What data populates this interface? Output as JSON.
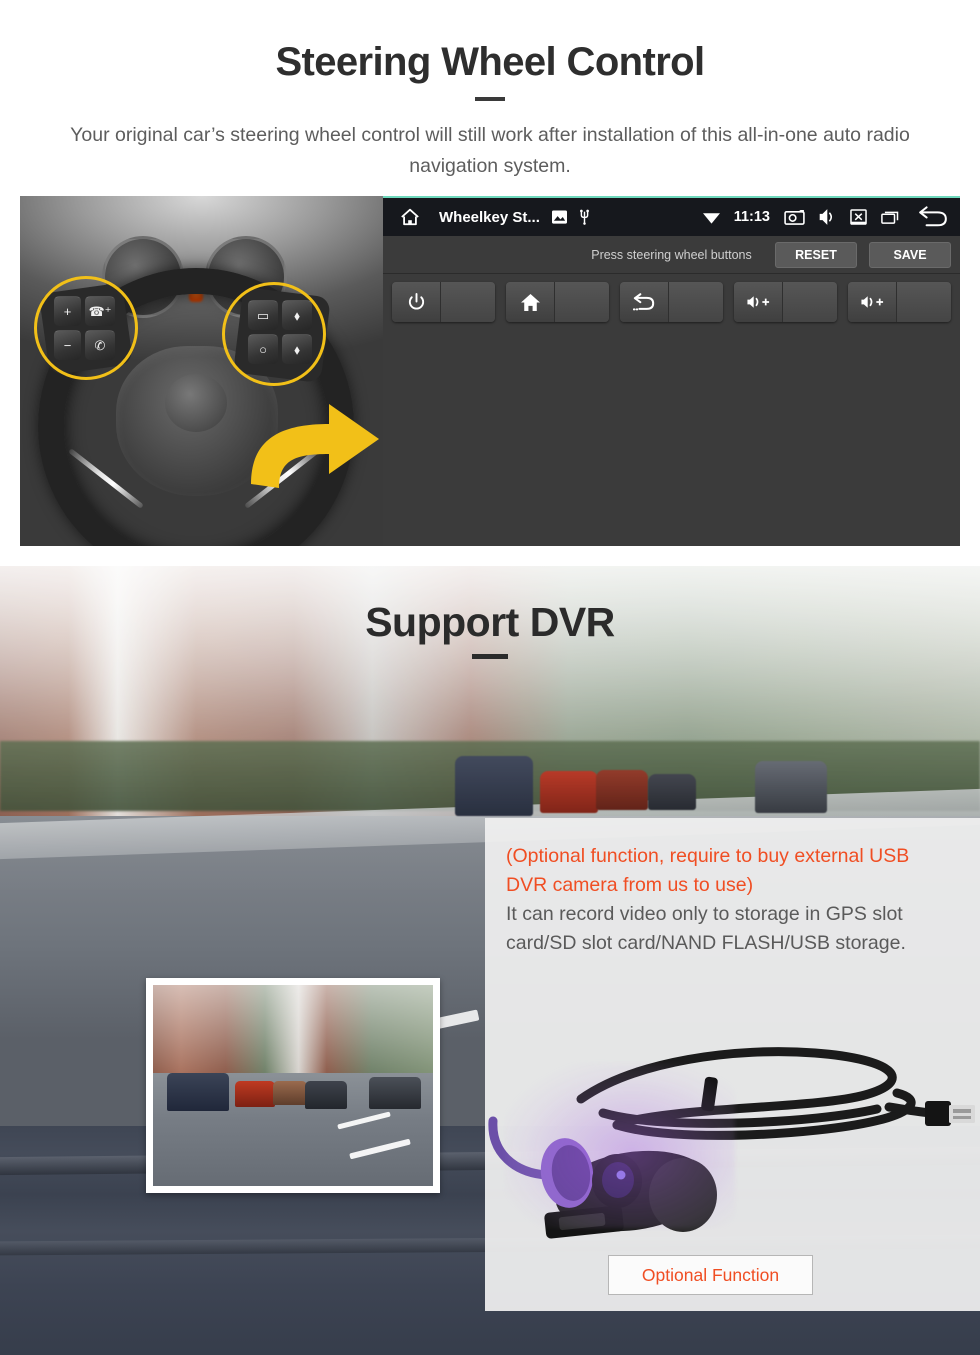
{
  "section_steering": {
    "title": "Steering Wheel Control",
    "subtitle": "Your original car’s steering wheel control will still work after installation of this all-in-one auto radio navigation system.",
    "photo_alt": "steering-wheel-with-highlighted-control-buttons",
    "head_unit": {
      "status_bar": {
        "home_icon": "home-icon",
        "app_title": "Wheelkey St...",
        "gallery_icon": "image-icon",
        "usb_icon": "usb-icon",
        "wifi_icon": "wifi-icon",
        "time": "11:13",
        "screenshot_icon": "camera-icon",
        "mute_icon": "speaker-mute-icon",
        "close_icon": "close-window-icon",
        "recents_icon": "recents-icon",
        "back_icon": "back-arrow-icon"
      },
      "toolbar": {
        "hint": "Press steering wheel buttons",
        "reset_label": "RESET",
        "save_label": "SAVE"
      },
      "keys": [
        {
          "icon": "power-icon",
          "name": "power",
          "value": ""
        },
        {
          "icon": "home-icon",
          "name": "home",
          "value": ""
        },
        {
          "icon": "back-icon",
          "name": "back",
          "value": ""
        },
        {
          "icon": "volume-up-icon",
          "name": "volume-up-1",
          "value": ""
        },
        {
          "icon": "volume-up-icon",
          "name": "volume-up-2",
          "value": ""
        }
      ]
    },
    "wheel_buttons_left": [
      "+",
      "☎⁺",
      "−",
      "✆"
    ],
    "wheel_buttons_right": [
      "▭",
      "⬧",
      "○",
      "⬧"
    ],
    "highlight_color": "#f2c018",
    "arrow_color": "#f2c018"
  },
  "section_dvr": {
    "title": "Support DVR",
    "note_orange": "(Optional function, require to buy external USB DVR camera from us to use)",
    "note_gray": "It can record video only to storage in GPS slot card/SD slot card/NAND FLASH/USB storage.",
    "optional_button_label": "Optional Function",
    "thumbnail_alt": "dashcam-recorded-street-footage",
    "product_alt": "usb-dvr-camera-with-cable",
    "orange_color": "#f04e23",
    "gray_text_color": "#5a5a5a"
  }
}
